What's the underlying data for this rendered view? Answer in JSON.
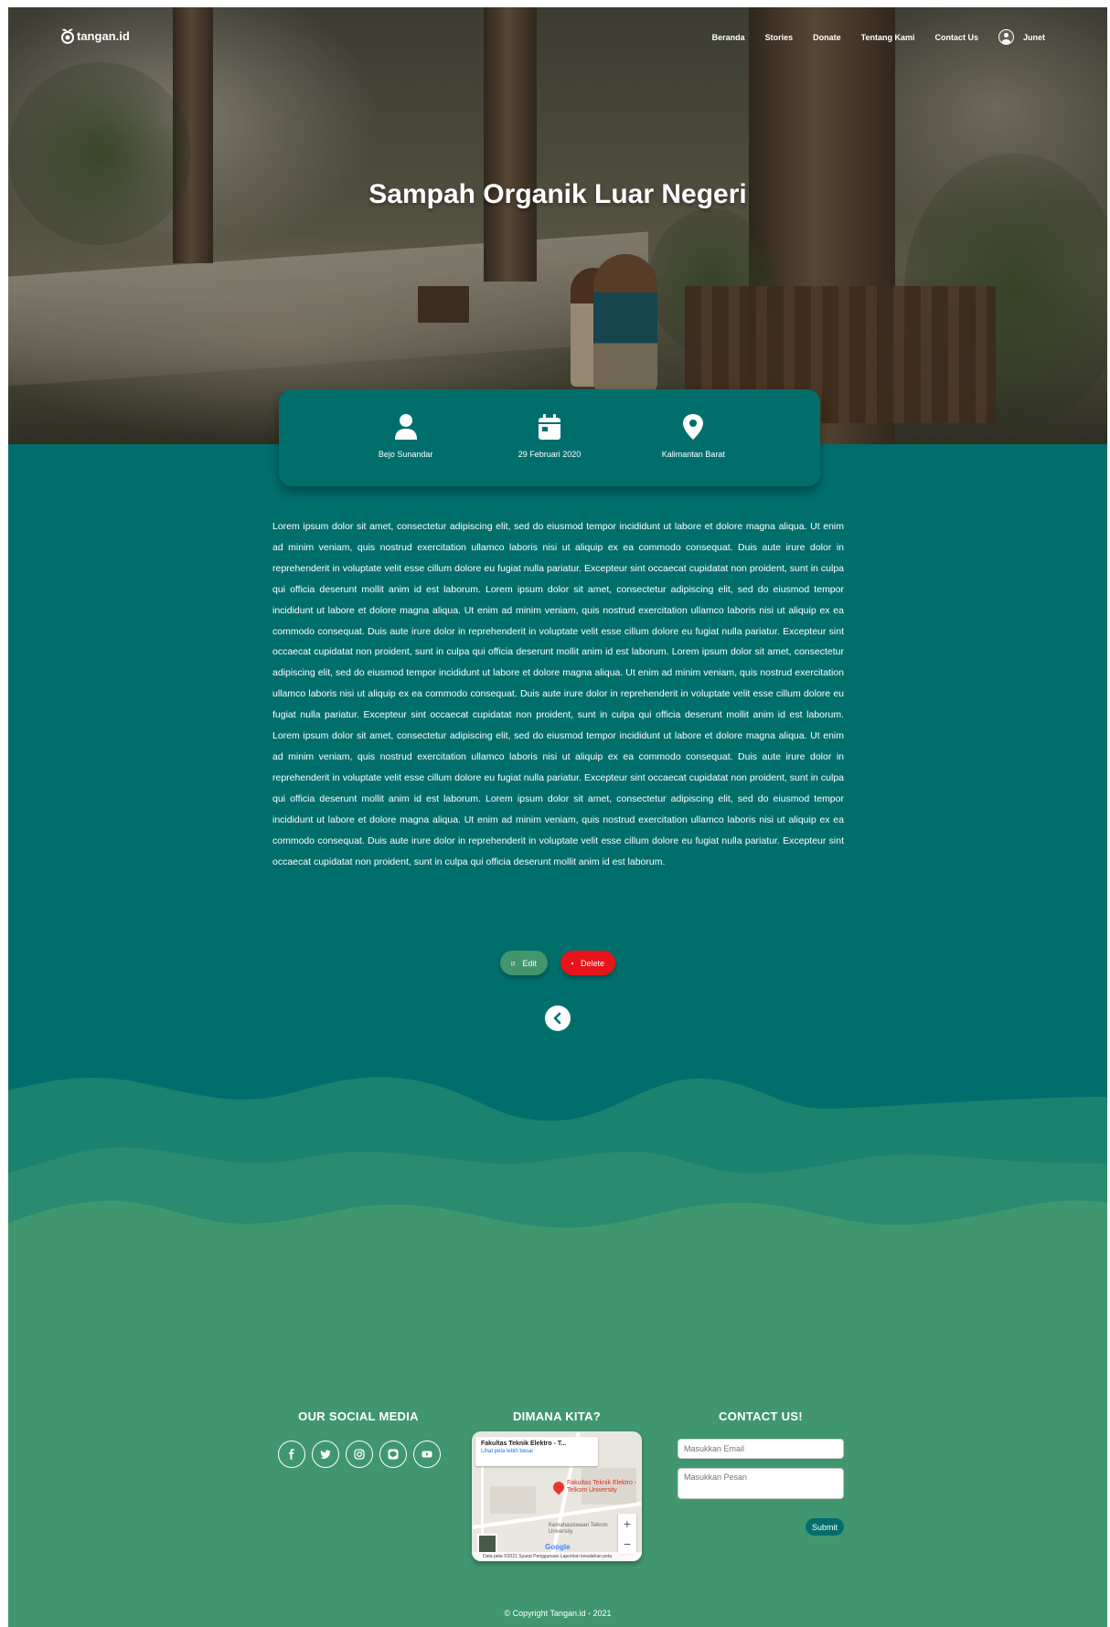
{
  "nav": {
    "logo_text": "tangan.id",
    "links": [
      "Beranda",
      "Stories",
      "Donate",
      "Tentang Kami",
      "Contact Us"
    ],
    "user_name": "Junet"
  },
  "hero": {
    "title": "Sampah Organik Luar Negeri"
  },
  "info": {
    "author": "Bejo Sunandar",
    "date": "29 Februari 2020",
    "location": "Kalimantan Barat"
  },
  "article": {
    "body": "Lorem ipsum dolor sit amet, consectetur adipiscing elit, sed do eiusmod tempor incididunt ut labore et dolore magna aliqua. Ut enim ad minim veniam, quis nostrud exercitation ullamco laboris nisi ut aliquip ex ea commodo consequat. Duis aute irure dolor in reprehenderit in voluptate velit esse cillum dolore eu fugiat nulla pariatur. Excepteur sint occaecat cupidatat non proident, sunt in culpa qui officia deserunt mollit anim id est laborum. Lorem ipsum dolor sit amet, consectetur adipiscing elit, sed do eiusmod tempor incididunt ut labore et dolore magna aliqua. Ut enim ad minim veniam, quis nostrud exercitation ullamco laboris nisi ut aliquip ex ea commodo consequat. Duis aute irure dolor in reprehenderit in voluptate velit esse cillum dolore eu fugiat nulla pariatur. Excepteur sint occaecat cupidatat non proident, sunt in culpa qui officia deserunt mollit anim id est laborum. Lorem ipsum dolor sit amet, consectetur adipiscing elit, sed do eiusmod tempor incididunt ut labore et dolore magna aliqua. Ut enim ad minim veniam, quis nostrud exercitation ullamco laboris nisi ut aliquip ex ea commodo consequat. Duis aute irure dolor in reprehenderit in voluptate velit esse cillum dolore eu fugiat nulla pariatur. Excepteur sint occaecat cupidatat non proident, sunt in culpa qui officia deserunt mollit anim id est laborum. Lorem ipsum dolor sit amet, consectetur adipiscing elit, sed do eiusmod tempor incididunt ut labore et dolore magna aliqua. Ut enim ad minim veniam, quis nostrud exercitation ullamco laboris nisi ut aliquip ex ea commodo consequat. Duis aute irure dolor in reprehenderit in voluptate velit esse cillum dolore eu fugiat nulla pariatur. Excepteur sint occaecat cupidatat non proident, sunt in culpa qui officia deserunt mollit anim id est laborum. Lorem ipsum dolor sit amet, consectetur adipiscing elit, sed do eiusmod tempor incididunt ut labore et dolore magna aliqua. Ut enim ad minim veniam, quis nostrud exercitation ullamco laboris nisi ut aliquip ex ea commodo consequat. Duis aute irure dolor in reprehenderit in voluptate velit esse cillum dolore eu fugiat nulla pariatur. Excepteur sint occaecat cupidatat non proident, sunt in culpa qui officia deserunt mollit anim id est laborum."
  },
  "actions": {
    "edit_label": "Edit",
    "delete_label": "Delete"
  },
  "footer": {
    "social_title": "OUR SOCIAL MEDIA",
    "social_icons": [
      "facebook-icon",
      "twitter-icon",
      "instagram-icon",
      "line-icon",
      "youtube-icon"
    ],
    "map_title": "DIMANA KITA?",
    "map": {
      "place_name": "Fakultas Teknik Elektro - T...",
      "place_link": "Lihat peta lebih besar",
      "pin_label": "Fakultas Teknik Elektro - Telkom University",
      "poi": "Kemahasiswaan Telkom University",
      "attribution": "Data peta ©2021   Syarat Penggunaan   Laporkan kesalahan peta",
      "google": "Google"
    },
    "contact_title": "CONTACT US!",
    "email_placeholder": "Masukkan Email",
    "message_placeholder": "Masukkan Pesan",
    "submit_label": "Submit",
    "copyright": "© Copyright Tangan.id - 2021"
  },
  "colors": {
    "primary": "#006f6c",
    "wave_mid": "#1b8270",
    "wave_light": "#40976f",
    "edit": "#43956e",
    "delete": "#e8141a"
  }
}
